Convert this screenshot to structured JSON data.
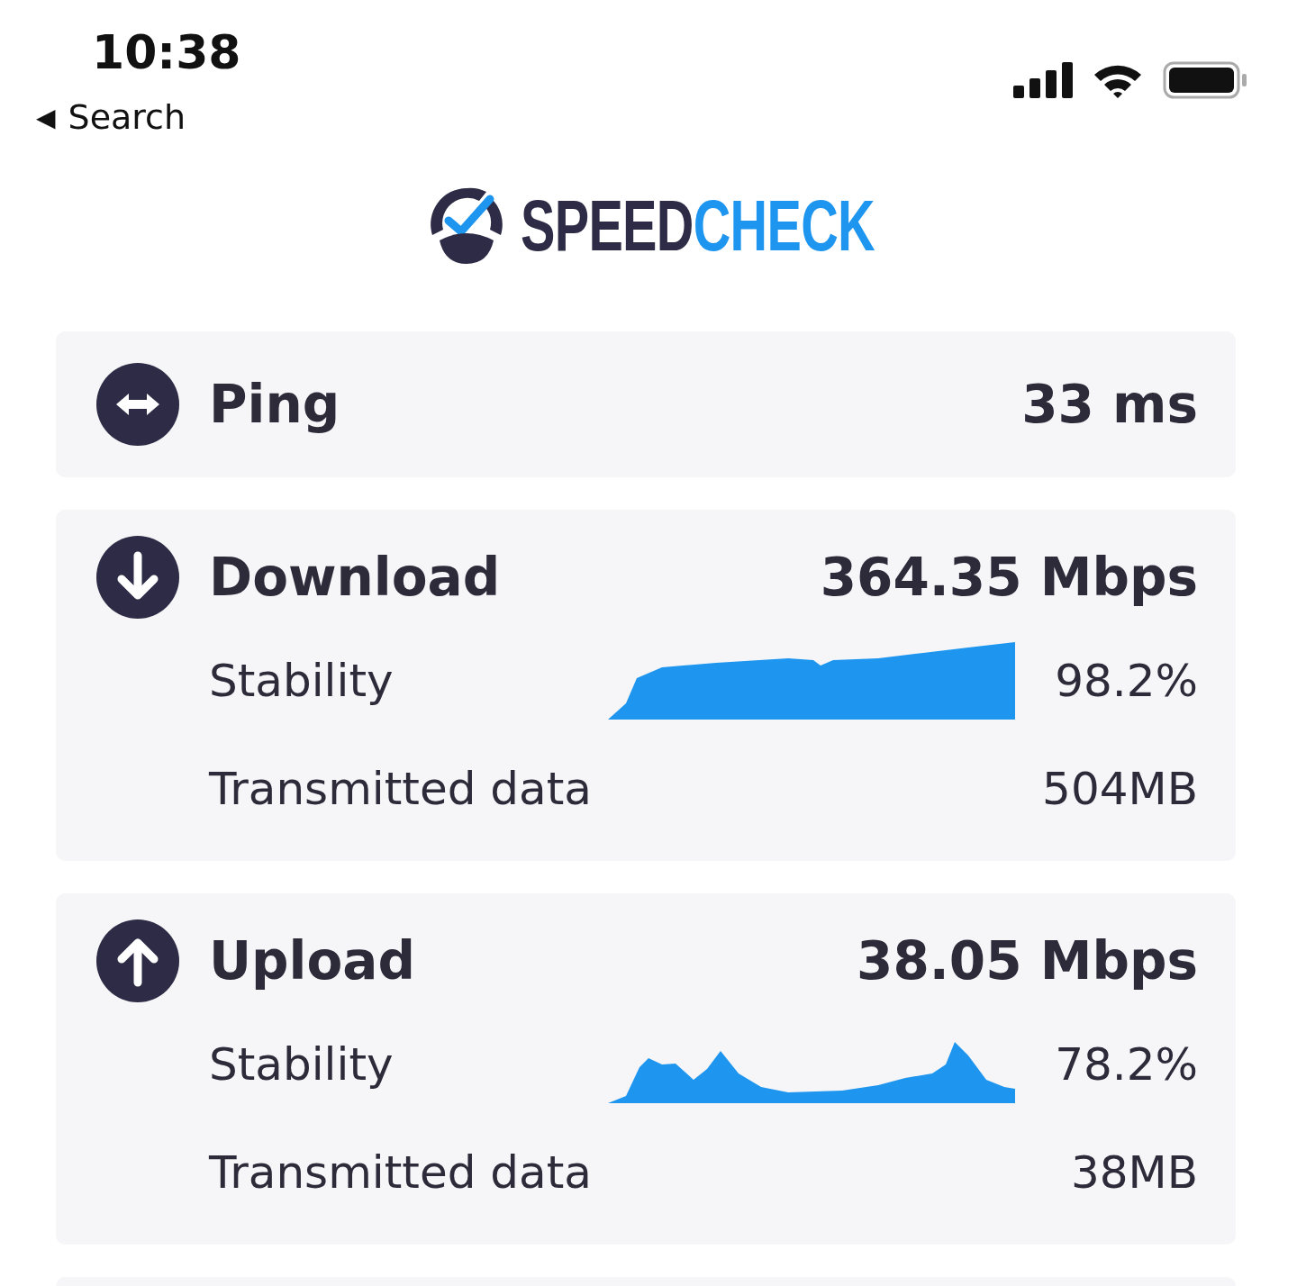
{
  "status_bar": {
    "time": "10:38",
    "back_arrow": "◀",
    "back_label": "Search"
  },
  "logo": {
    "part_1": "SPEED",
    "part_2": "CHECK"
  },
  "results": [
    {
      "kind": "ping",
      "title": "Ping",
      "value": "33 ms"
    },
    {
      "kind": "download",
      "title": "Download",
      "value": "364.35 Mbps",
      "details": [
        {
          "kind": "graph",
          "label": "Stability",
          "value": "98.2%"
        },
        {
          "kind": "text",
          "label": "Transmitted data",
          "value": "504MB"
        }
      ]
    },
    {
      "kind": "upload",
      "title": "Upload",
      "value": "38.05 Mbps",
      "details": [
        {
          "kind": "graph",
          "label": "Stability",
          "value": "78.2%"
        },
        {
          "kind": "text",
          "label": "Transmitted data",
          "value": "38MB"
        }
      ]
    }
  ]
}
